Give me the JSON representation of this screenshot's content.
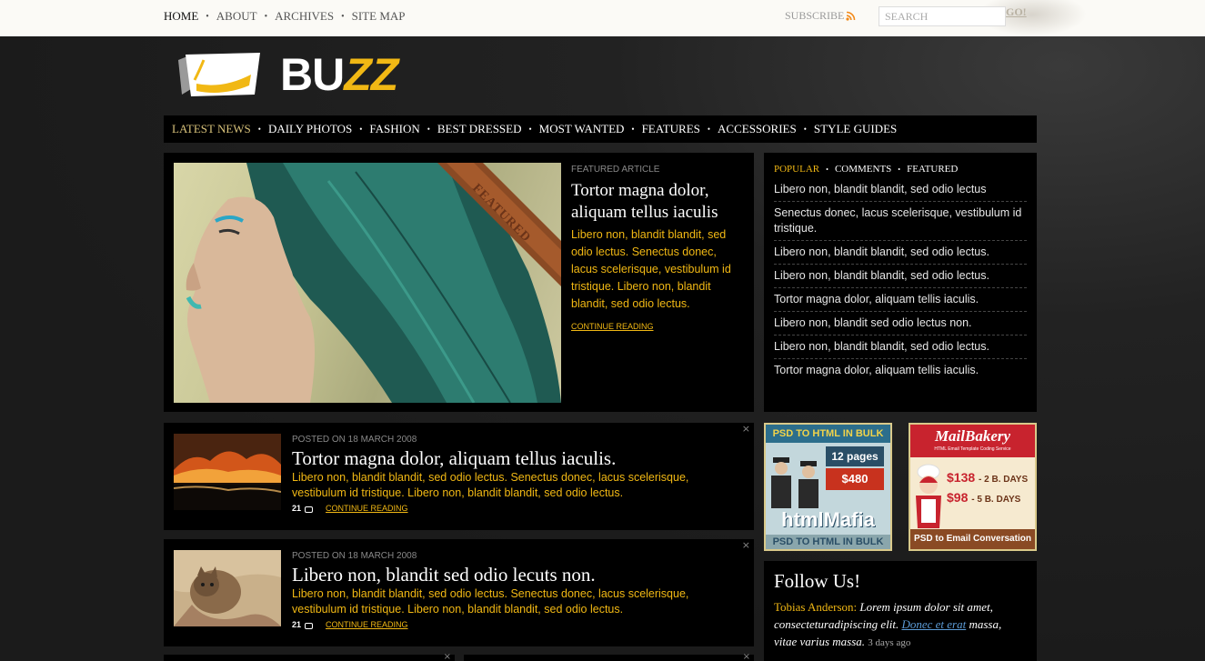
{
  "topnav": {
    "items": [
      {
        "label": "HOME"
      },
      {
        "label": "ABOUT"
      },
      {
        "label": "ARCHIVES"
      },
      {
        "label": "SITE MAP"
      }
    ],
    "separator": "•",
    "subscribe": "SUBSCRIBE",
    "search_placeholder": "SEARCH",
    "go": "GO!"
  },
  "logo": {
    "part1": "BU",
    "part2": "ZZ"
  },
  "mainnav": {
    "items": [
      "LATEST NEWS",
      "DAILY PHOTOS",
      "FASHION",
      "BEST DRESSED",
      "MOST WANTED",
      "FEATURES",
      "ACCESSORIES",
      "STYLE GUIDES"
    ],
    "separator": "•"
  },
  "featured": {
    "label": "FEATURED ARTICLE",
    "ribbon": "FEATURED",
    "title": "Tortor magna dolor, aliquam tellus iaculis",
    "excerpt": "Libero non, blandit blandit, sed odio lectus. Senectus donec, lacus scelerisque, vestibulum id tristique. Libero non, blandit blandit, sed odio lectus.",
    "continue": "CONTINUE READING"
  },
  "sidebar": {
    "tabs": [
      "POPULAR",
      "COMMENTS",
      "FEATURED"
    ],
    "separator": "•",
    "items": [
      "Libero non, blandit blandit, sed odio lectus",
      "Senectus donec, lacus scelerisque, vestibulum id tristique.",
      "Libero non, blandit blandit, sed odio lectus.",
      "Libero non, blandit blandit, sed odio lectus.",
      "Tortor magna dolor, aliquam tellis iaculis.",
      "Libero non, blandit sed odio lectus non.",
      "Libero non, blandit blandit, sed odio lectus.",
      "Tortor magna dolor, aliquam tellis iaculis."
    ]
  },
  "posts": [
    {
      "meta": "POSTED ON 18 MARCH 2008",
      "title": "Tortor magna dolor, aliquam tellus iaculis.",
      "excerpt": "Libero non, blandit blandit, sed odio lectus. Senectus donec, lacus scelerisque, vestibulum id tristique. Libero non, blandit blandit, sed odio lectus.",
      "comments": "21",
      "continue": "CONTINUE READING",
      "close": "×"
    },
    {
      "meta": "POSTED ON 18 MARCH 2008",
      "title": "Libero non, blandit sed odio lecuts non.",
      "excerpt": "Libero non, blandit blandit, sed odio lectus. Senectus donec, lacus scelerisque, vestibulum id tristique. Libero non, blandit blandit, sed odio lectus.",
      "comments": "21",
      "continue": "CONTINUE READING",
      "close": "×"
    }
  ],
  "ads": {
    "ad1": {
      "top": "PSD TO HTML IN BULK",
      "pages": "12 pages",
      "price": "$480",
      "brand": "htmlMafia",
      "bottom": "PSD TO HTML IN BULK"
    },
    "ad2": {
      "brand": "MailBakery",
      "tagline": "HTML Email Template Coding Service",
      "price1": "$138",
      "price1_days": "- 2 B. DAYS",
      "price2": "$98",
      "price2_days": "- 5 B. DAYS",
      "bottom": "PSD to Email Conversation"
    }
  },
  "follow": {
    "title": "Follow Us!",
    "author": "Tobias Anderson:",
    "text1": "Lorem ipsum dolor sit amet, consecteturadipiscing elit.",
    "link": "Donec et erat",
    "text2": "massa, vitae varius massa.",
    "time": "3 days ago"
  },
  "colors": {
    "accent": "#f1b814",
    "panel": "#000000",
    "background": "#1d1d1d"
  }
}
